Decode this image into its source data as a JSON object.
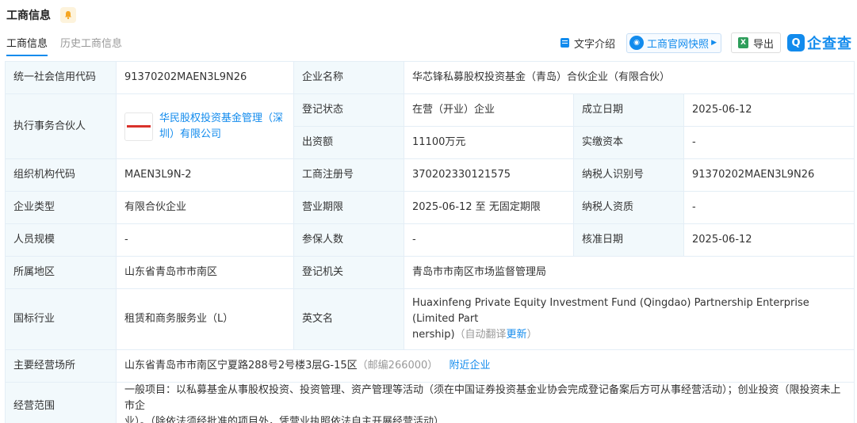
{
  "header": {
    "title": "工商信息",
    "tabs": [
      {
        "label": "工商信息",
        "active": true
      },
      {
        "label": "历史工商信息",
        "active": false
      }
    ],
    "tools": {
      "text_intro": "文字介绍",
      "snapshot": "工商官网快照",
      "export": "导出",
      "brand": "企查查"
    }
  },
  "colors": {
    "accent": "#128bed",
    "label_bg": "#f2f9fc",
    "border": "#e4eef6"
  },
  "info": {
    "credit_code_label": "统一社会信用代码",
    "credit_code": "91370202MAEN3L9N26",
    "company_name_label": "企业名称",
    "company_name": "华芯锋私募股权投资基金（青岛）合伙企业（有限合伙）",
    "partner_label": "执行事务合伙人",
    "partner_line1": "华民股权投资基金管理（深",
    "partner_line2": "圳）有限公司",
    "reg_status_label": "登记状态",
    "reg_status": "在营（开业）企业",
    "established_label": "成立日期",
    "established": "2025-06-12",
    "capital_label": "出资额",
    "capital": "11100万元",
    "paid_capital_label": "实缴资本",
    "paid_capital": "-",
    "org_code_label": "组织机构代码",
    "org_code": "MAEN3L9N-2",
    "reg_no_label": "工商注册号",
    "reg_no": "370202330121575",
    "taxpayer_id_label": "纳税人识别号",
    "taxpayer_id": "91370202MAEN3L9N26",
    "type_label": "企业类型",
    "type": "有限合伙企业",
    "term_label": "营业期限",
    "term": "2025-06-12 至 无固定期限",
    "taxpayer_qual_label": "纳税人资质",
    "taxpayer_qual": "-",
    "staff_label": "人员规模",
    "staff": "-",
    "insured_label": "参保人数",
    "insured": "-",
    "approved_label": "核准日期",
    "approved": "2025-06-12",
    "region_label": "所属地区",
    "region": "山东省青岛市市南区",
    "authority_label": "登记机关",
    "authority": "青岛市市南区市场监督管理局",
    "industry_label": "国标行业",
    "industry": "租赁和商务服务业（L）",
    "english_label": "英文名",
    "english_line1": "Huaxinfeng Private Equity Investment Fund (Qingdao) Partnership Enterprise (Limited Part",
    "english_line2": "nership)",
    "auto_translate": "（自动翻译",
    "update": "更新",
    "close_paren": "）",
    "address_label": "主要经营场所",
    "address": "山东省青岛市市南区宁夏路288号2号楼3层G-15区",
    "postcode": "（邮编266000）",
    "nearby": "附近企业",
    "scope_label": "经营范围",
    "scope_line1": "一般项目：以私募基金从事股权投资、投资管理、资产管理等活动（须在中国证券投资基金业协会完成登记备案后方可从事经营活动）；创业投资（限投资未上市企",
    "scope_line2": "业）。（除依法须经批准的项目外，凭营业执照依法自主开展经营活动）"
  }
}
